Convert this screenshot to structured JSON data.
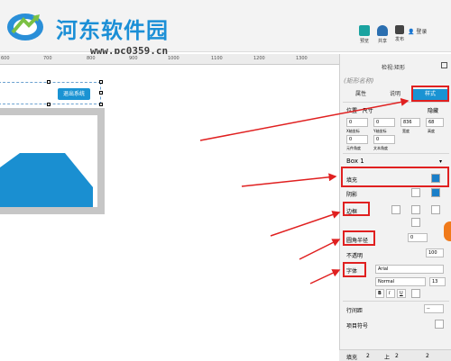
{
  "site": {
    "name": "河东软件园",
    "url": "www.pc0359.cn"
  },
  "toolbar": {
    "items": [
      {
        "label": "预览"
      },
      {
        "label": "共享"
      },
      {
        "label": "发布"
      }
    ],
    "login": "登录"
  },
  "ruler": {
    "ticks": [
      "600",
      "700",
      "800",
      "900",
      "1000",
      "1100",
      "1200",
      "1300"
    ]
  },
  "canvas": {
    "exit_button": "退出系统"
  },
  "panel": {
    "title_prefix": "检视:",
    "title": "矩形",
    "shape_name_placeholder": "(矩形名称)",
    "tabs": {
      "properties": "属性",
      "notes": "说明",
      "style": "样式"
    },
    "location_label": "位置 · 尺寸",
    "hide_label": "隐藏",
    "x_value": "0",
    "y_value": "0",
    "width_value": "836",
    "height_value": "68",
    "x_caption": "X轴坐标",
    "y_caption": "Y轴坐标",
    "w_caption": "宽度",
    "h_caption": "高度",
    "rot_value": "0",
    "text_rot_value": "0",
    "rot_caption": "元件角度",
    "text_rot_caption": "文本角度",
    "style_name": "Box 1",
    "fill_label": "填充",
    "shadow_label": "阴影",
    "border_label": "边框",
    "radius_label": "圆角半径",
    "radius_value": "0",
    "opacity_label": "不透明",
    "opacity_value": "100",
    "font_label": "字体",
    "font_family": "Arial",
    "font_weight": "Normal",
    "font_size": "13",
    "bold": "B",
    "italic": "I",
    "underline": "U",
    "line_height_label": "行间距",
    "bullets_label": "项目符号",
    "line_height_value": "--",
    "bottom_fill": "填充",
    "bottom_val1": "2",
    "bottom_up": "上",
    "bottom_val2": "2",
    "bottom_val3": "2"
  },
  "colors": {
    "accent": "#1a93d3",
    "fill_swatch": "#1a7fc9",
    "annotation": "#e02020",
    "chart_blue": "#1a8fd1"
  }
}
